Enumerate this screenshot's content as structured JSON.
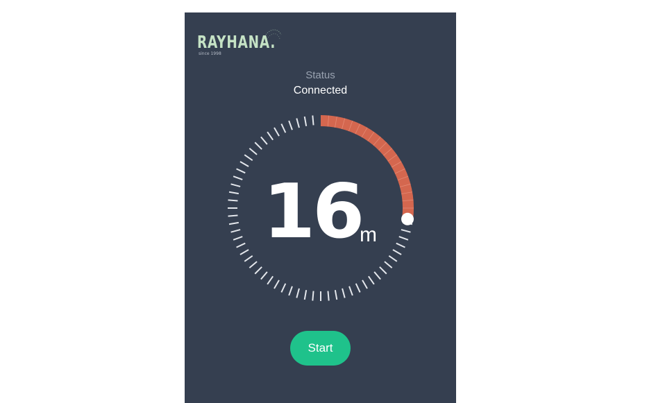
{
  "brand": {
    "name": "RAYHANA.",
    "tagline": "since 1998"
  },
  "status": {
    "label": "Status",
    "value": "Connected"
  },
  "timer": {
    "value": "16",
    "unit": "m",
    "progress_fraction": 0.27,
    "tick_count": 72
  },
  "actions": {
    "start_label": "Start"
  },
  "colors": {
    "panel": "#353f50",
    "progress": "#d4674f",
    "tick": "#e4e7ec",
    "start_button": "#1fc28b",
    "logo": "#c5e2c5"
  }
}
